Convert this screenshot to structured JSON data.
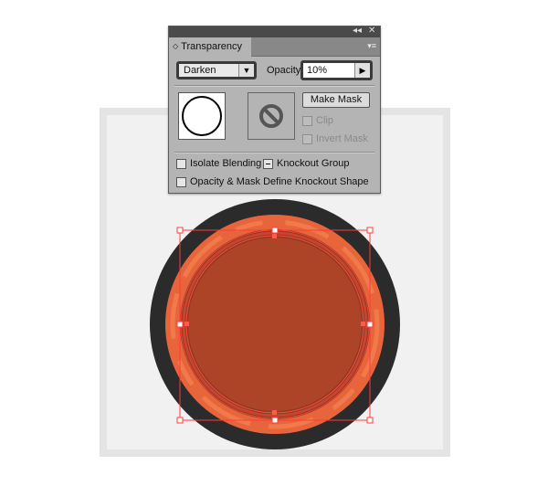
{
  "panel": {
    "tab_label": "Transparency",
    "tab_arrows": "◇",
    "menu_icon": "▾≡",
    "collapse_icon": "◂◂",
    "close_icon": "✕",
    "blend_mode": {
      "selected": "Darken",
      "dropdown_icon": "▼"
    },
    "opacity": {
      "label": "Opacity:",
      "value": "10%",
      "arrow_icon": "▶"
    },
    "make_mask_label": "Make Mask",
    "clip_label": "Clip",
    "invert_mask_label": "Invert Mask",
    "isolate_blending_label": "Isolate Blending",
    "knockout_group_label": "Knockout Group",
    "opacity_mask_knockout_label": "Opacity & Mask Define Knockout Shape"
  },
  "colors": {
    "artboard": "#f1f1f1",
    "dark_ring": "#2b2b2b",
    "orange_ring": "#e8643a",
    "fill_center": "#ad4428",
    "selection": "#ff2a2a"
  }
}
